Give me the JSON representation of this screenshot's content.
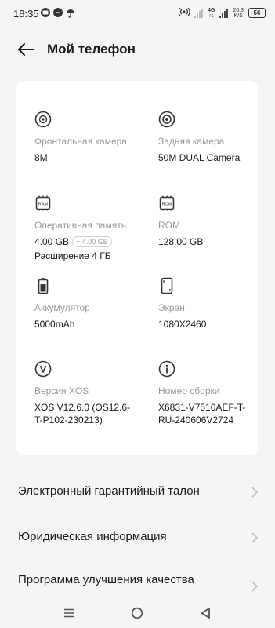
{
  "status_bar": {
    "time": "18:35",
    "network": "4G",
    "speed_value": "26.3",
    "speed_unit": "K/S",
    "battery": "56",
    "notification_icons": [
      "message-icon",
      "chat-icon",
      "umbrella-icon"
    ]
  },
  "header": {
    "title": "Мой телефон"
  },
  "specs": {
    "front_camera": {
      "label": "Фронтальная камера",
      "value": "8M",
      "icon": "front-camera-icon"
    },
    "rear_camera": {
      "label": "Задняя камера",
      "value": "50M DUAL Camera",
      "icon": "rear-camera-icon"
    },
    "ram": {
      "label": "Оперативная память",
      "value": "4.00 GB",
      "chip": "+ 4.00 GB",
      "extension": "Расширение 4 ГБ",
      "icon": "ram-icon",
      "icon_text": "RAM"
    },
    "rom": {
      "label": "ROM",
      "value": "128.00 GB",
      "icon": "rom-icon",
      "icon_text": "ROM"
    },
    "battery": {
      "label": "Аккумулятор",
      "value": "5000mAh",
      "icon": "battery-icon"
    },
    "screen": {
      "label": "Экран",
      "value": "1080X2460",
      "icon": "screen-icon"
    },
    "xos": {
      "label": "Версия XOS",
      "value": "XOS V12.6.0 (OS12.6-T-P102-230213)",
      "icon": "xos-icon"
    },
    "build": {
      "label": "Номер сборки",
      "value": "X6831-V7510AEF-T-RU-240606V2724",
      "icon": "info-icon"
    }
  },
  "menu": [
    {
      "label": "Электронный гарантийный талон"
    },
    {
      "label": "Юридическая информация"
    },
    {
      "label": "Программа улучшения качества"
    }
  ],
  "nav_bar": {
    "buttons": [
      "menu-icon",
      "home-icon",
      "back-triangle-icon"
    ]
  }
}
